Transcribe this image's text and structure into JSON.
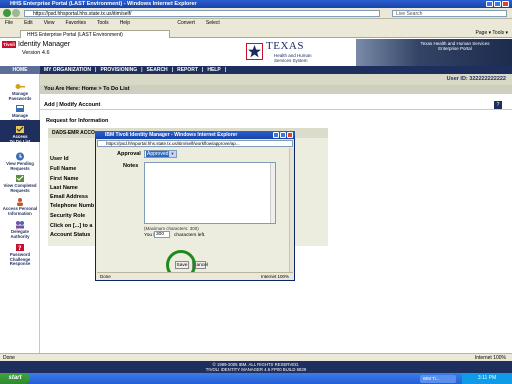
{
  "browser": {
    "title": "HHS Enterprise Portal (LAST Environment) - Windows Internet Explorer",
    "address": "https://psd.hhsportal.hhs.state.tx.us/itim/self/",
    "search_placeholder": "Live Search",
    "menu": [
      "File",
      "Edit",
      "View",
      "Favorites",
      "Tools",
      "Help"
    ],
    "toolbar_extra": [
      "Convert",
      "Select"
    ],
    "tab_label": "HHS Enterprise Portal (LAST Environment)",
    "tab_tools": "Page ▾  Tools ▾",
    "status_left": "Done",
    "status_right": "Internet    100%"
  },
  "header": {
    "logo_badge": "Tivoli",
    "app_name": "Identity Manager",
    "version": "Version 4.6",
    "texas": "TEXAS",
    "texas_sub": "Health and Human\nServices System",
    "photo_caption": "Texas Health and Human Services\nEnterprise Portal"
  },
  "nav": {
    "home": "HOME",
    "items": [
      "MY ORGANIZATION",
      "|",
      "PROVISIONING",
      "|",
      "SEARCH",
      "|",
      "REPORT",
      "|",
      "HELP",
      "|"
    ]
  },
  "user_id": "User ID: 322222222222",
  "breadcrumb": "You Are Here: Home > To Do List",
  "page_title": "Add | Modify Account",
  "request_heading": "Request for Information",
  "form": {
    "header": "DADS-EMR ACCO",
    "fields": [
      "User Id",
      "Full Name",
      "First Name",
      "Last Name",
      "Email Address",
      "Telephone Numb",
      "Security Role",
      "Click on [...] to a",
      "Account Status"
    ]
  },
  "sidebar": [
    {
      "label": "Manage\nPasswords",
      "icon": "key-icon"
    },
    {
      "label": "Manage\nAccounts",
      "icon": "accounts-icon"
    },
    {
      "label": "Access\nTo Do List",
      "icon": "todo-icon",
      "selected": true
    },
    {
      "label": "View Pending\nRequests",
      "icon": "pending-icon"
    },
    {
      "label": "View Completed\nRequests",
      "icon": "completed-icon"
    },
    {
      "label": "Access Personal\nInformation",
      "icon": "person-icon"
    },
    {
      "label": "Delegate\nAuthority",
      "icon": "delegate-icon"
    },
    {
      "label": "Password Challenge\nResponse",
      "icon": "challenge-icon"
    }
  ],
  "footer": "© 1999-2005 IBM. ALL RIGHTS RESERVED.\nTIVOLI IDENTITY MANAGER 4.6 FP00 BUILD 5829",
  "taskbar": {
    "start": "start",
    "task": "IBM Ti...",
    "clock": "3:11 PM"
  },
  "popup": {
    "title": "IBM Tivoli Identity Manager - Windows Internet Explorer",
    "address": "https://psd.hhsportal.hhs.state.tx.us/itim/self/workflow/approve/ap...",
    "approval_label": "Approval",
    "approval_value": "Approved",
    "notes_label": "Notes",
    "max_chars": "(Maximum characters: 300)",
    "you_have": "You have",
    "chars_left_value": "300",
    "chars_left_suffix": "characters left.",
    "save_label": "Save",
    "cancel_label": "Cancel",
    "status_left": "Done",
    "status_right": "Internet    100%"
  },
  "colors": {
    "nav": "#1f2f5d",
    "accent": "#c8102e",
    "highlight_circle": "#1e8a1e"
  }
}
